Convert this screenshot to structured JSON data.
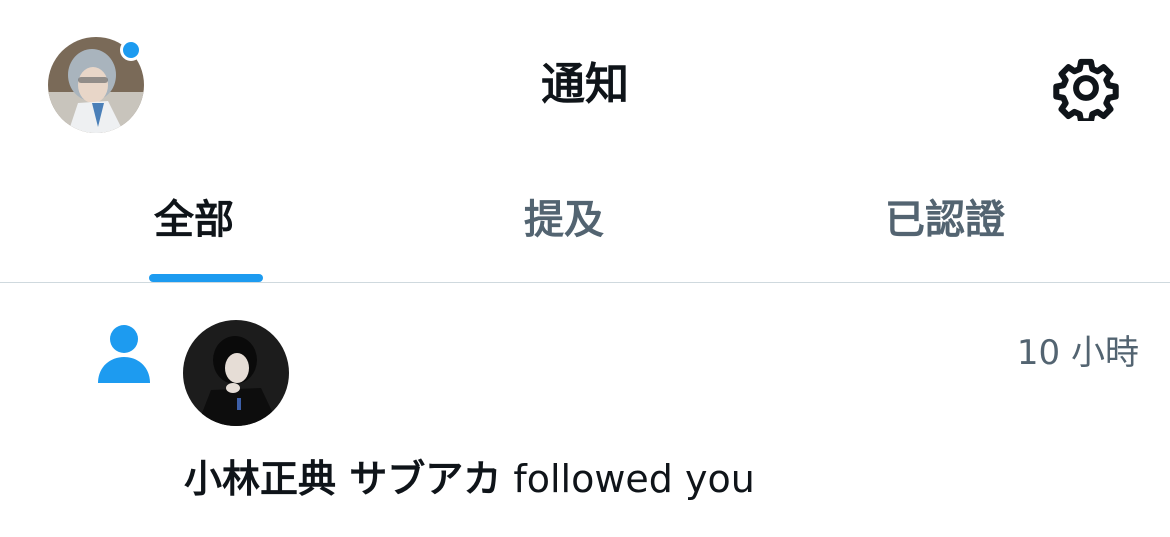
{
  "header": {
    "title": "通知",
    "profile_icon": "user-avatar",
    "unread_dot_color": "#1d9bf0",
    "settings_icon": "gear-icon"
  },
  "tabs": [
    {
      "label": "全部",
      "active": true
    },
    {
      "label": "提及",
      "active": false
    },
    {
      "label": "已認證",
      "active": false
    }
  ],
  "accent_color": "#1d9bf0",
  "notifications": [
    {
      "type_icon": "person-follow-icon",
      "time": "10 小時",
      "name": "小林正典 サブアカ",
      "action": "followed you"
    }
  ]
}
